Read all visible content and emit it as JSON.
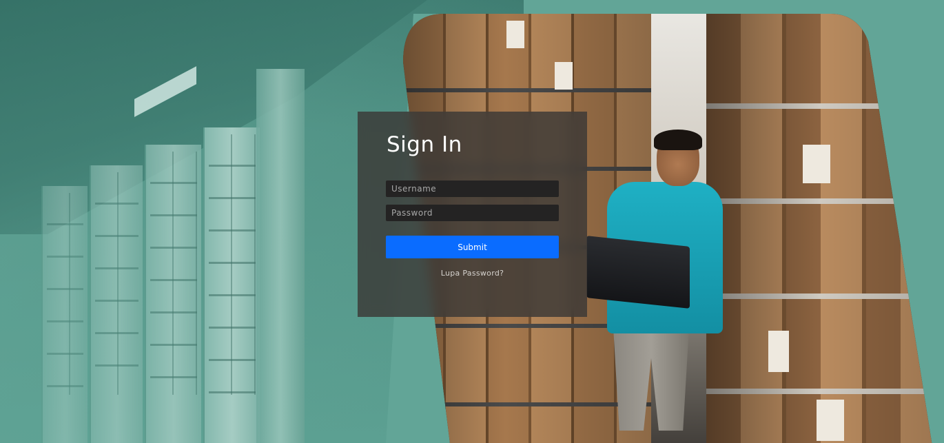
{
  "login": {
    "title": "Sign In",
    "username_placeholder": "Username",
    "password_placeholder": "Password",
    "submit_label": "Submit",
    "forgot_password_label": "Lupa Password?"
  },
  "theme": {
    "background": "#62a597",
    "card_background": "#3a3836",
    "input_background": "#242323",
    "submit_color": "#0a6cff",
    "title_color": "#ffffff"
  }
}
